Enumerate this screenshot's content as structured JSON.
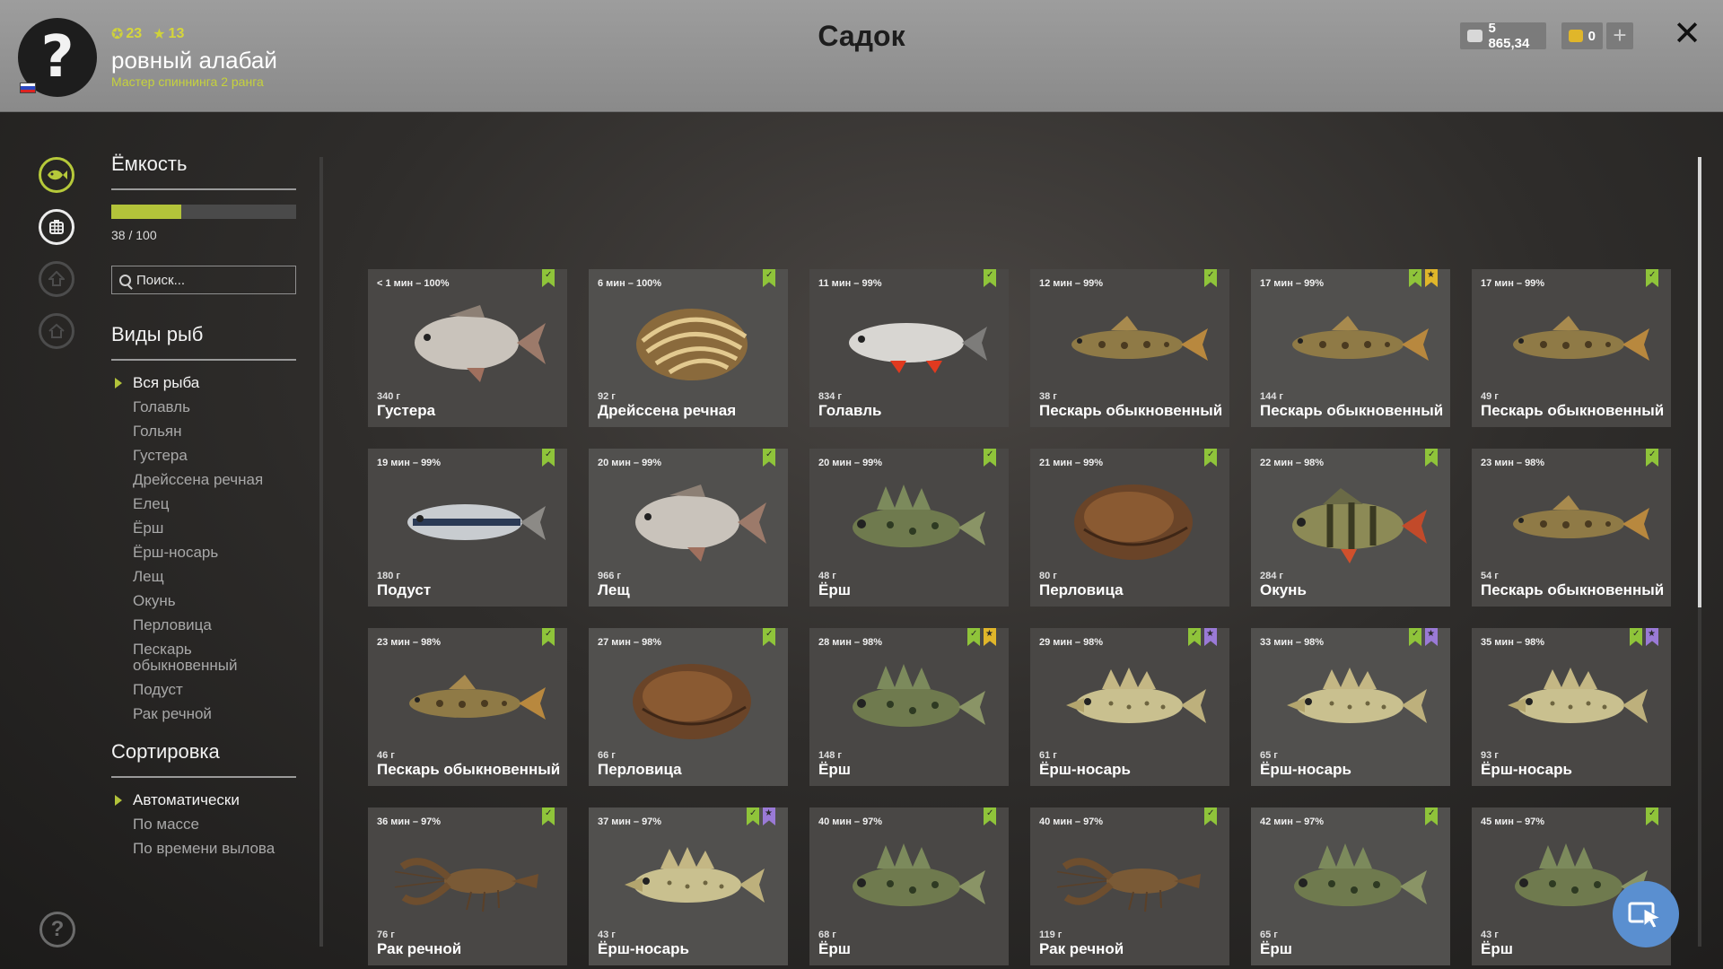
{
  "header": {
    "title": "Садок",
    "avatar_glyph": "?",
    "level": "23",
    "rank_level": "13",
    "player_name": "ровный алабай",
    "player_rank": "Мастер спиннинга 2 ранга",
    "silver": "5 865,34",
    "gold": "0",
    "plus": "+",
    "close": "✕"
  },
  "panel": {
    "capacity_title": "Ёмкость",
    "capacity_text": "38 / 100",
    "capacity_fraction": 0.38,
    "search_placeholder": "Поиск...",
    "species_title": "Виды рыб",
    "species": [
      "Вся рыба",
      "Голавль",
      "Гольян",
      "Густера",
      "Дрейссена речная",
      "Елец",
      "Ёрш",
      "Ёрш-носарь",
      "Лещ",
      "Окунь",
      "Перловица",
      "Пескарь обыкновенный",
      "Подуст",
      "Рак речной"
    ],
    "sort_title": "Сортировка",
    "sort": [
      "Автоматически",
      "По массе",
      "По времени вылова"
    ]
  },
  "rail_icons": [
    "fish-icon",
    "keepnet-icon",
    "trophy-icon",
    "home-icon"
  ],
  "help": "?",
  "cards": [
    {
      "time": "< 1 мин – 100%",
      "weight": "340 г",
      "name": "Густера",
      "kind": "bream",
      "flags": [
        "green"
      ]
    },
    {
      "time": "6 мин – 100%",
      "weight": "92 г",
      "name": "Дрейссена речная",
      "kind": "mussel-striped",
      "flags": [
        "green"
      ]
    },
    {
      "time": "11 мин – 99%",
      "weight": "834 г",
      "name": "Голавль",
      "kind": "chub",
      "flags": [
        "green"
      ]
    },
    {
      "time": "12 мин – 99%",
      "weight": "38 г",
      "name": "Пескарь обыкновенный",
      "kind": "gudgeon",
      "flags": [
        "green"
      ]
    },
    {
      "time": "17 мин – 99%",
      "weight": "144 г",
      "name": "Пескарь обыкновенный",
      "kind": "gudgeon",
      "flags": [
        "green",
        "yellow"
      ]
    },
    {
      "time": "17 мин – 99%",
      "weight": "49 г",
      "name": "Пескарь обыкновенный",
      "kind": "gudgeon",
      "flags": [
        "green"
      ]
    },
    {
      "time": "19 мин – 99%",
      "weight": "180 г",
      "name": "Подуст",
      "kind": "nase",
      "flags": [
        "green"
      ]
    },
    {
      "time": "20 мин – 99%",
      "weight": "966 г",
      "name": "Лещ",
      "kind": "bream",
      "flags": [
        "green"
      ]
    },
    {
      "time": "20 мин – 99%",
      "weight": "48 г",
      "name": "Ёрш",
      "kind": "ruffe",
      "flags": [
        "green"
      ]
    },
    {
      "time": "21 мин – 99%",
      "weight": "80 г",
      "name": "Перловица",
      "kind": "mussel",
      "flags": [
        "green"
      ]
    },
    {
      "time": "22 мин – 98%",
      "weight": "284 г",
      "name": "Окунь",
      "kind": "perch",
      "flags": [
        "green"
      ]
    },
    {
      "time": "23 мин – 98%",
      "weight": "54 г",
      "name": "Пескарь обыкновенный",
      "kind": "gudgeon",
      "flags": [
        "green"
      ]
    },
    {
      "time": "23 мин – 98%",
      "weight": "46 г",
      "name": "Пескарь обыкновенный",
      "kind": "gudgeon",
      "flags": [
        "green"
      ]
    },
    {
      "time": "27 мин – 98%",
      "weight": "66 г",
      "name": "Перловица",
      "kind": "mussel",
      "flags": [
        "green"
      ]
    },
    {
      "time": "28 мин – 98%",
      "weight": "148 г",
      "name": "Ёрш",
      "kind": "ruffe",
      "flags": [
        "green",
        "yellow"
      ]
    },
    {
      "time": "29 мин – 98%",
      "weight": "61 г",
      "name": "Ёрш-носарь",
      "kind": "nosed-ruffe",
      "flags": [
        "green",
        "purple"
      ]
    },
    {
      "time": "33 мин – 98%",
      "weight": "65 г",
      "name": "Ёрш-носарь",
      "kind": "nosed-ruffe",
      "flags": [
        "green",
        "purple"
      ]
    },
    {
      "time": "35 мин – 98%",
      "weight": "93 г",
      "name": "Ёрш-носарь",
      "kind": "nosed-ruffe",
      "flags": [
        "green",
        "purple"
      ]
    },
    {
      "time": "36 мин – 97%",
      "weight": "76 г",
      "name": "Рак речной",
      "kind": "crayfish",
      "flags": [
        "green"
      ]
    },
    {
      "time": "37 мин – 97%",
      "weight": "43 г",
      "name": "Ёрш-носарь",
      "kind": "nosed-ruffe",
      "flags": [
        "green",
        "purple"
      ]
    },
    {
      "time": "40 мин – 97%",
      "weight": "68 г",
      "name": "Ёрш",
      "kind": "ruffe",
      "flags": [
        "green"
      ]
    },
    {
      "time": "40 мин – 97%",
      "weight": "119 г",
      "name": "Рак речной",
      "kind": "crayfish",
      "flags": [
        "green"
      ]
    },
    {
      "time": "42 мин – 97%",
      "weight": "65 г",
      "name": "Ёрш",
      "kind": "ruffe",
      "flags": [
        "green"
      ]
    },
    {
      "time": "45 мин – 97%",
      "weight": "43 г",
      "name": "Ёрш",
      "kind": "ruffe",
      "flags": [
        "green"
      ]
    }
  ],
  "colors": {
    "accent": "#b3c33a",
    "flag_green": "#8fc43a",
    "flag_yellow": "#e0b62a",
    "flag_purple": "#9a7ad6",
    "float_button": "#5a8fd0"
  }
}
